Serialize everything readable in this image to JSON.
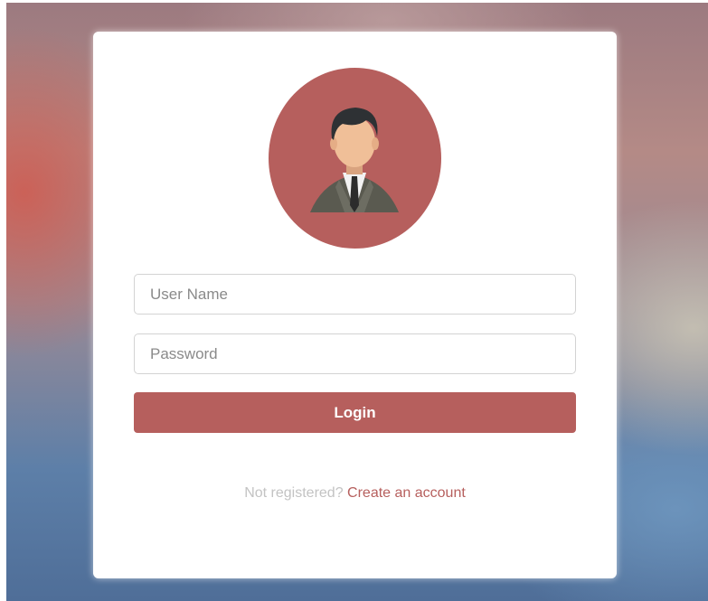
{
  "colors": {
    "accent": "#b65f5d",
    "card": "#ffffff",
    "muted_text": "#c3c3c3",
    "placeholder_text": "#8a8a8a"
  },
  "avatar": {
    "icon": "user-businessman-icon"
  },
  "form": {
    "username_placeholder": "User Name",
    "username_value": "",
    "password_placeholder": "Password",
    "password_value": "",
    "login_label": "Login"
  },
  "register": {
    "prompt": "Not registered?",
    "link_label": "Create an account"
  }
}
